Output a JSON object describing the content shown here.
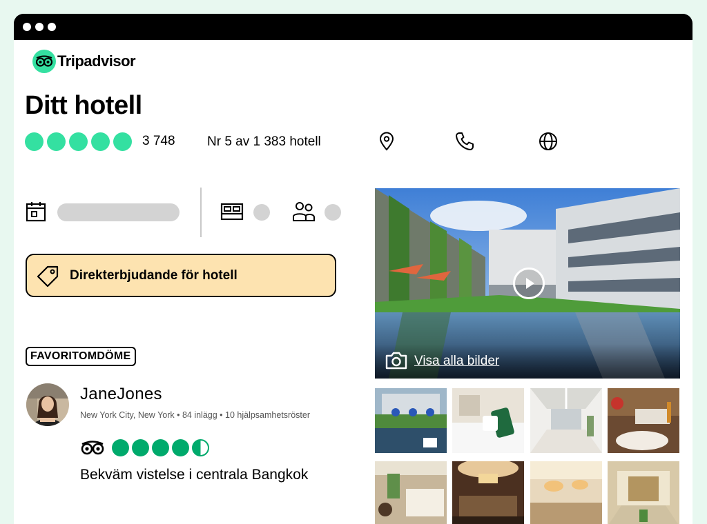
{
  "brand": {
    "name": "Tripadvisor"
  },
  "hotel": {
    "title": "Ditt hotell",
    "rating_bubbles": 5,
    "review_count": "3 748",
    "ranking": "Nr 5 av 1 383 hotell"
  },
  "actions": {
    "location_icon": "map-pin-icon",
    "phone_icon": "phone-icon",
    "website_icon": "globe-icon"
  },
  "booking": {
    "calendar_icon": "calendar-icon",
    "rooms_icon": "bed-icon",
    "guests_icon": "people-icon"
  },
  "deal": {
    "label": "Direkterbjudande för hotell",
    "icon": "price-tag-icon"
  },
  "review": {
    "badge": "FAVORITOMDÖME",
    "reviewer_name": "JaneJones",
    "reviewer_meta": "New York City, New York • 84 inlägg • 10 hjälpsamhetsröster",
    "rating": 4.5,
    "title": "Bekväm vistelse i centrala Bangkok"
  },
  "gallery": {
    "see_all_label": "Visa alla bilder",
    "camera_icon": "camera-icon",
    "play_icon": "play-icon"
  },
  "colors": {
    "brand_green": "#34e0a1",
    "rating_green": "#00aa6c",
    "deal_bg": "#fde3b0",
    "page_bg": "#e8f8f0"
  }
}
